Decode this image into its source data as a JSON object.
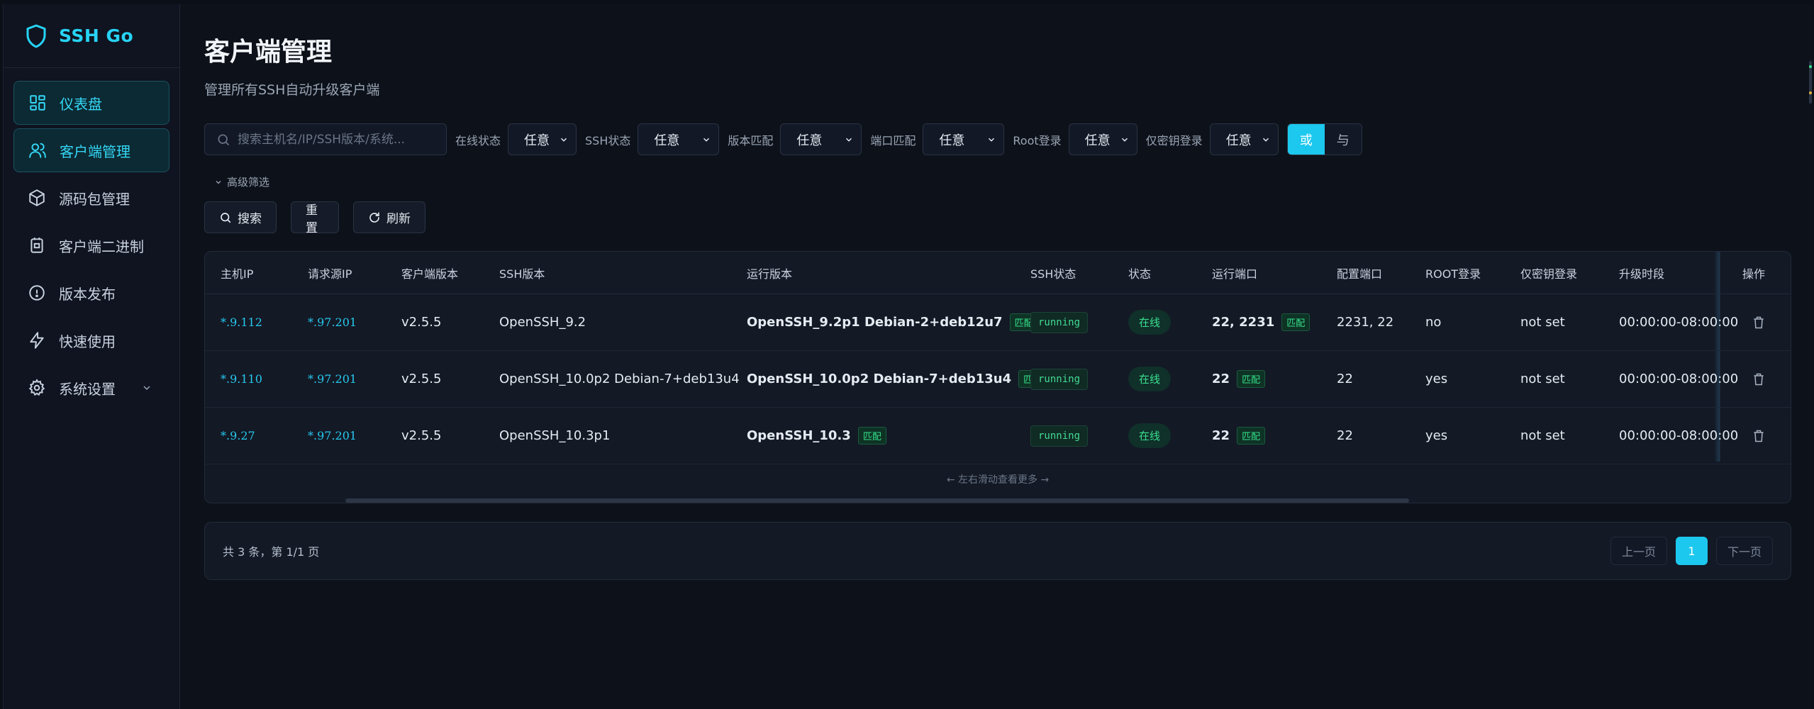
{
  "app": {
    "name": "SSH Go"
  },
  "sidebar": {
    "items": [
      {
        "label": "仪表盘",
        "icon": "dashboard-icon"
      },
      {
        "label": "客户端管理",
        "icon": "users-icon"
      },
      {
        "label": "源码包管理",
        "icon": "package-icon"
      },
      {
        "label": "客户端二进制",
        "icon": "binary-icon"
      },
      {
        "label": "版本发布",
        "icon": "release-icon"
      },
      {
        "label": "快速使用",
        "icon": "lightning-icon"
      },
      {
        "label": "系统设置",
        "icon": "gear-icon"
      }
    ]
  },
  "page": {
    "title": "客户端管理",
    "subtitle": "管理所有SSH自动升级客户端"
  },
  "filters": {
    "search_placeholder": "搜索主机名/IP/SSH版本/系统...",
    "online_label": "在线状态",
    "online_value": "任意",
    "ssh_label": "SSH状态",
    "ssh_value": "任意",
    "version_label": "版本匹配",
    "version_value": "任意",
    "port_label": "端口匹配",
    "port_value": "任意",
    "root_label": "Root登录",
    "root_value": "任意",
    "keyonly_label": "仅密钥登录",
    "keyonly_value": "任意",
    "logic_or": "或",
    "logic_and": "与",
    "advanced": "高级筛选"
  },
  "actions": {
    "search": "搜索",
    "reset": "重置",
    "refresh": "刷新"
  },
  "table": {
    "headers": {
      "host_ip": "主机IP",
      "src_ip": "请求源IP",
      "client_ver": "客户端版本",
      "ssh_ver": "SSH版本",
      "run_ver": "运行版本",
      "ssh_status": "SSH状态",
      "status": "状态",
      "run_port": "运行端口",
      "cfg_port": "配置端口",
      "root": "ROOT登录",
      "keyonly": "仅密钥登录",
      "window": "升级时段",
      "op": "操作"
    },
    "match_badge": "匹配",
    "rows": [
      {
        "host_ip": "*.9.112",
        "src_ip": "*.97.201",
        "client_ver": "v2.5.5",
        "ssh_ver": "OpenSSH_9.2",
        "run_ver": "OpenSSH_9.2p1 Debian-2+deb12u7",
        "ssh_status": "running",
        "status": "在线",
        "run_port": "22, 2231",
        "cfg_port": "2231, 22",
        "root": "no",
        "keyonly": "not set",
        "window": "00:00:00-08:00:00"
      },
      {
        "host_ip": "*.9.110",
        "src_ip": "*.97.201",
        "client_ver": "v2.5.5",
        "ssh_ver": "OpenSSH_10.0p2 Debian-7+deb13u4",
        "run_ver": "OpenSSH_10.0p2 Debian-7+deb13u4",
        "ssh_status": "running",
        "status": "在线",
        "run_port": "22",
        "cfg_port": "22",
        "root": "yes",
        "keyonly": "not set",
        "window": "00:00:00-08:00:00"
      },
      {
        "host_ip": "*.9.27",
        "src_ip": "*.97.201",
        "client_ver": "v2.5.5",
        "ssh_ver": "OpenSSH_10.3p1",
        "run_ver": "OpenSSH_10.3",
        "ssh_status": "running",
        "status": "在线",
        "run_port": "22",
        "cfg_port": "22",
        "root": "yes",
        "keyonly": "not set",
        "window": "00:00:00-08:00:00"
      }
    ],
    "scroll_hint": "← 左右滑动查看更多 →"
  },
  "pager": {
    "info": "共 3 条，第 1/1 页",
    "prev": "上一页",
    "current": "1",
    "next": "下一页"
  },
  "colors": {
    "accent": "#1cc8ee",
    "success": "#39e08f",
    "bg": "#0d1119"
  }
}
